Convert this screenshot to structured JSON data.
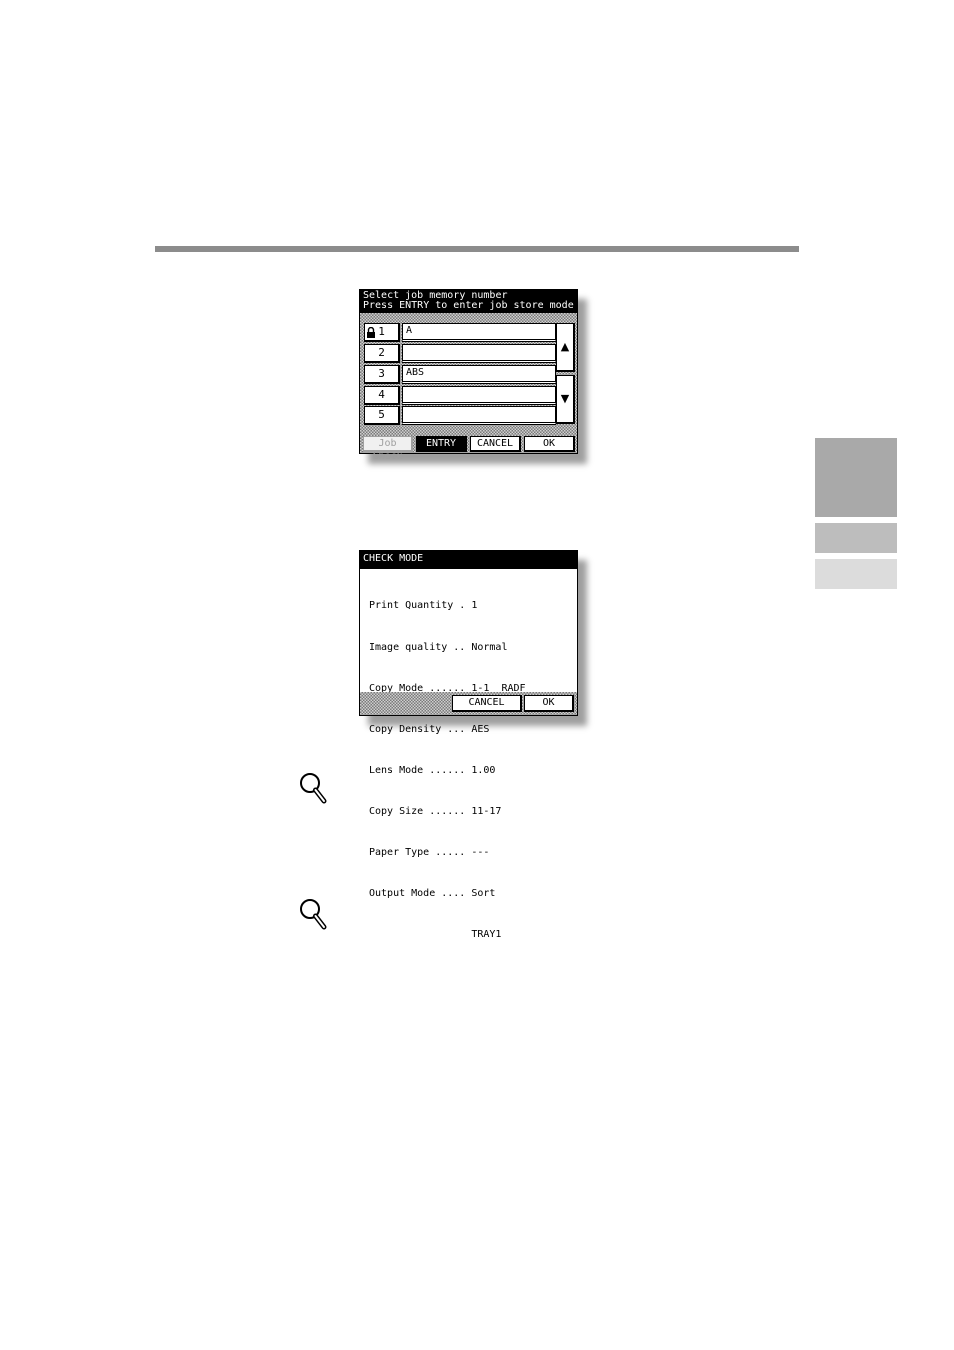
{
  "screen1": {
    "header_line1": "Select job memory number",
    "header_line2": "Press ENTRY to enter job store mode",
    "rows": [
      {
        "number": "1",
        "name": "A",
        "locked": true
      },
      {
        "number": "2",
        "name": "",
        "locked": false
      },
      {
        "number": "3",
        "name": "ABS",
        "locked": false
      },
      {
        "number": "4",
        "name": "",
        "locked": false
      },
      {
        "number": "5",
        "name": "",
        "locked": false
      }
    ],
    "scroll_up_glyph": "▲",
    "scroll_down_glyph": "▼",
    "job_check_label": "Job Check",
    "entry_label": "ENTRY",
    "cancel_label": "CANCEL",
    "ok_label": "OK"
  },
  "screen2": {
    "title": "CHECK MODE",
    "lines": [
      "Print Quantity . 1",
      "Image quality .. Normal",
      "Copy Mode ...... 1-1  RADF",
      "Copy Density ... AES",
      "Lens Mode ...... 1.00",
      "Copy Size ...... 11-17",
      "Paper Type ..... ---",
      "Output Mode .... Sort",
      "                 TRAY1"
    ],
    "cancel_label": "CANCEL",
    "ok_label": "OK"
  },
  "icons": [
    "magnifier-icon",
    "magnifier-icon"
  ],
  "colors": {
    "rule": "#8c8c8c",
    "tab_dark": "#a9a9a9",
    "tab_mid": "#bdbdbd",
    "tab_light": "#dcdcdc"
  }
}
